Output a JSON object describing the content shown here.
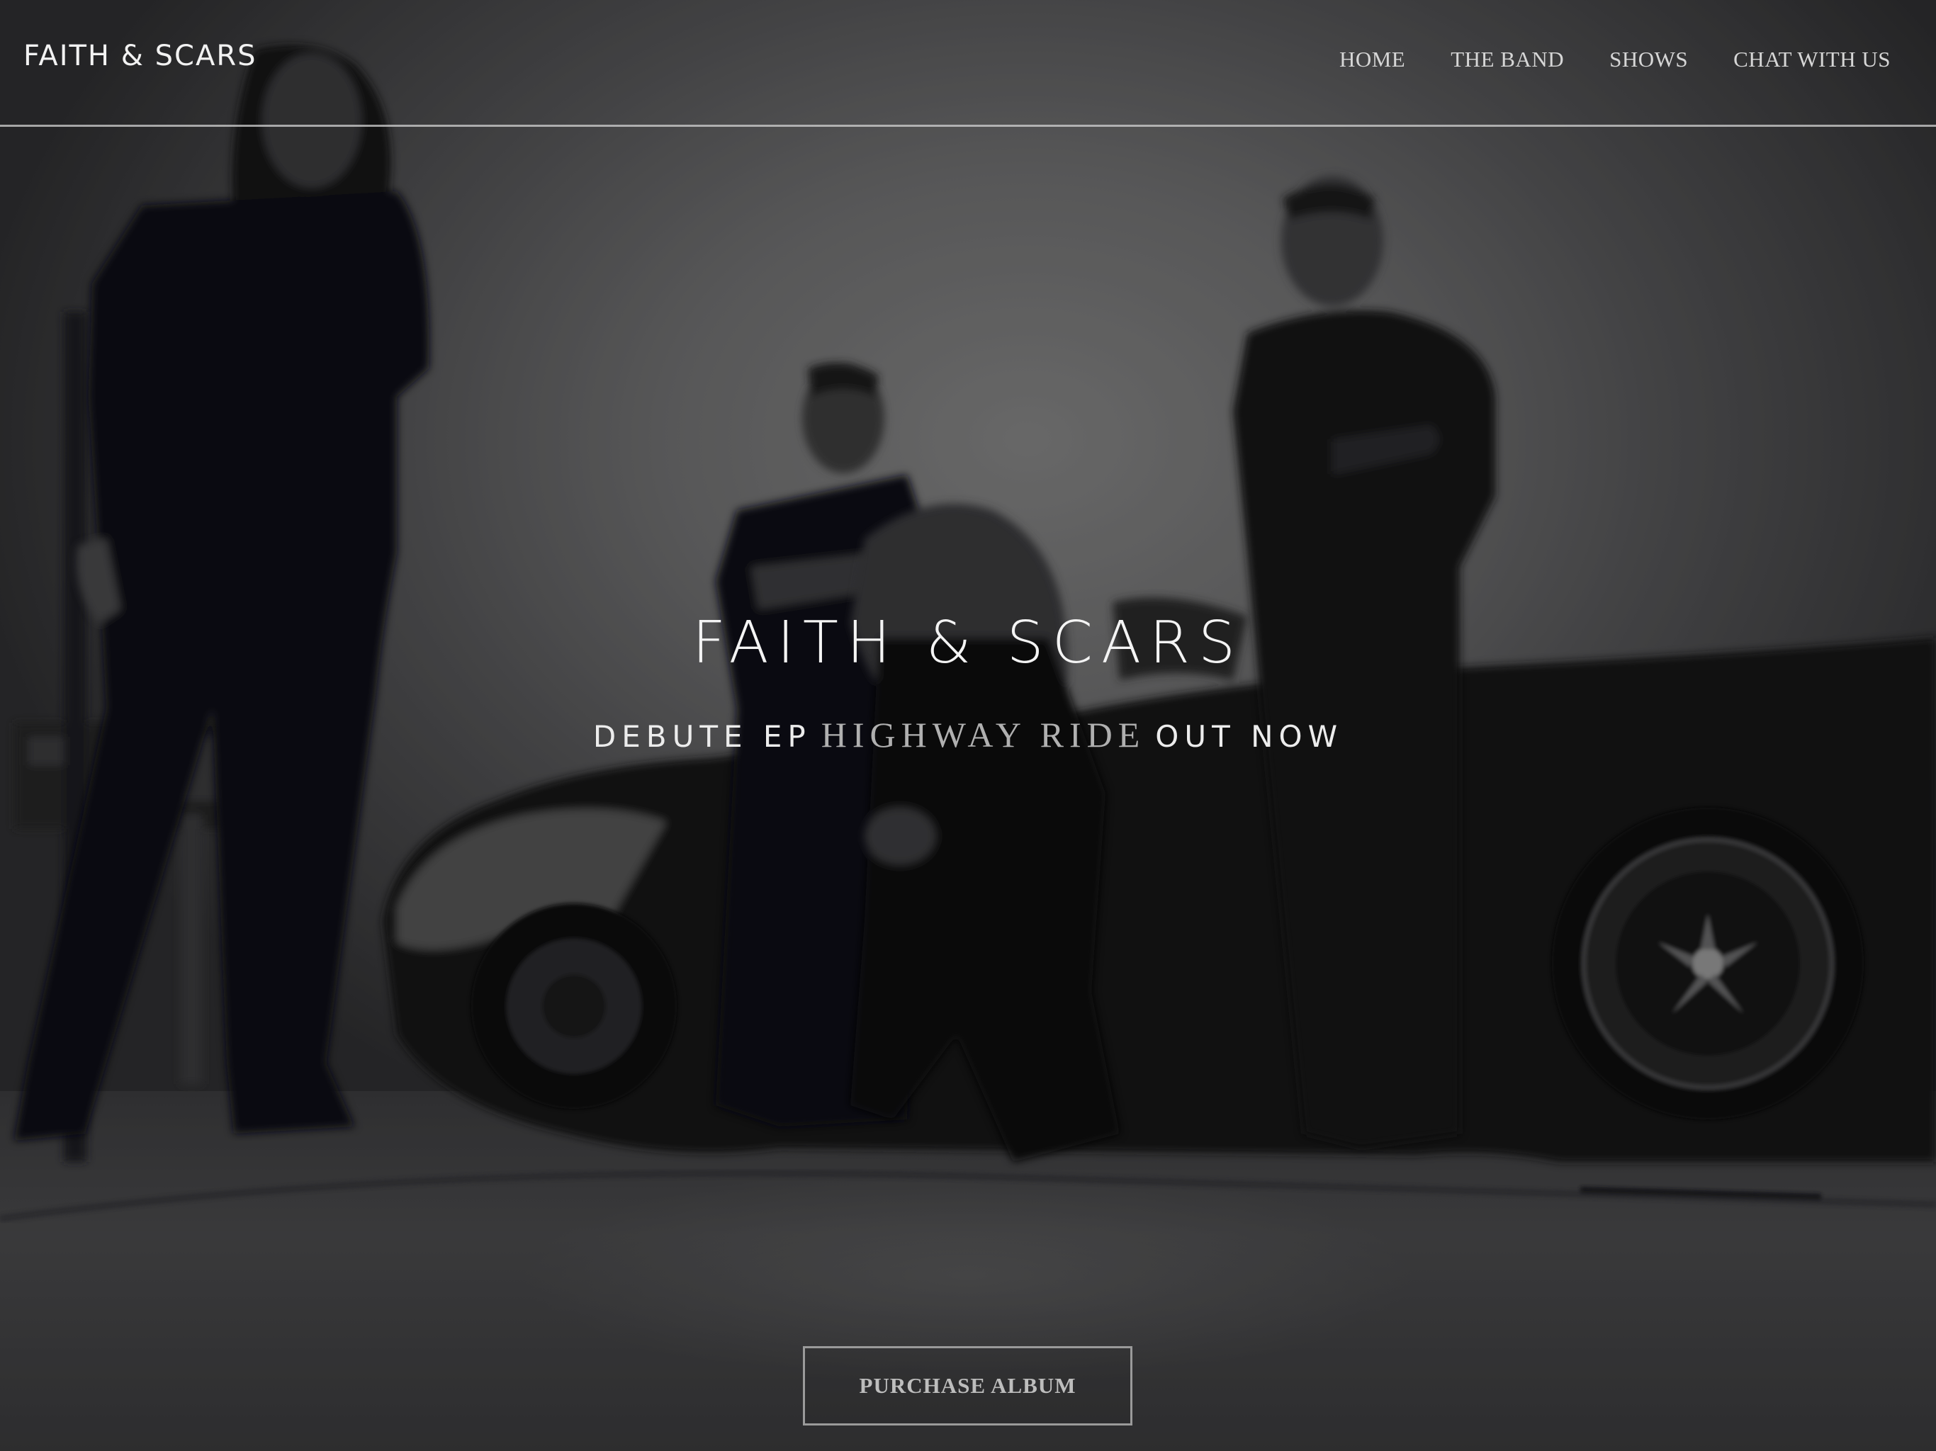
{
  "header": {
    "brand": "FAITH & SCARS",
    "nav": [
      {
        "label": "HOME"
      },
      {
        "label": "THE BAND"
      },
      {
        "label": "SHOWS"
      },
      {
        "label": "CHAT WITH US"
      }
    ]
  },
  "hero": {
    "title": "FAITH & SCARS",
    "subtitle_prefix": "DEBUTE EP",
    "subtitle_album": "HIGHWAY RIDE",
    "subtitle_suffix": "OUT NOW",
    "background_image": "band-photo"
  },
  "cta": {
    "label": "PURCHASE ALBUM"
  },
  "colors": {
    "text_primary": "#f2f2f2",
    "nav_text": "#d6d6d6",
    "album_text": "#b0b0b0",
    "button_border": "#9a9a9a",
    "button_text": "#bdbdbd",
    "header_rule": "#d2d2d2"
  }
}
